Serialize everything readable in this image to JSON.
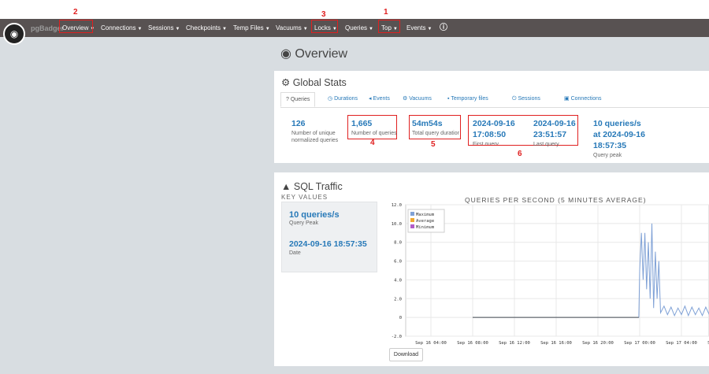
{
  "brand": {
    "name": "pgBadger"
  },
  "nav": [
    {
      "label": "Overview"
    },
    {
      "label": "Connections"
    },
    {
      "label": "Sessions"
    },
    {
      "label": "Checkpoints"
    },
    {
      "label": "Temp Files"
    },
    {
      "label": "Vacuums"
    },
    {
      "label": "Locks"
    },
    {
      "label": "Queries"
    },
    {
      "label": "Top"
    },
    {
      "label": "Events"
    }
  ],
  "annotations": [
    "1",
    "2",
    "3",
    "4",
    "5",
    "6"
  ],
  "page_title": "Overview",
  "global_stats": {
    "title": "Global Stats",
    "tabs": [
      "Queries",
      "Durations",
      "Events",
      "Vacuums",
      "Temporary files",
      "Sessions",
      "Connections"
    ],
    "stats": [
      {
        "value": "126",
        "label1": "Number of unique",
        "label2": "normalized queries"
      },
      {
        "value": "1,665",
        "label1": "Number of queries"
      },
      {
        "value": "54m54s",
        "label1": "Total query duration"
      },
      {
        "value1": "2024-09-16",
        "value2": "17:08:50",
        "label1": "First query"
      },
      {
        "value1": "2024-09-16",
        "value2": "23:51:57",
        "label1": "Last query"
      },
      {
        "value1": "10 queries/s",
        "value2": "at 2024-09-16",
        "value3": "18:57:35",
        "label1": "Query peak"
      }
    ]
  },
  "sql_traffic": {
    "title": "SQL Traffic",
    "key_values_title": "KEY VALUES",
    "peak_value": "10 queries/s",
    "peak_label": "Query Peak",
    "date_value": "2024-09-16 18:57:35",
    "date_label": "Date",
    "download_label": "Download"
  },
  "colors": {
    "navbar": "#585252",
    "accent": "#2779b8",
    "annotation": "#e02020"
  },
  "chart_data": {
    "type": "line",
    "title": "QUERIES PER SECOND (5 MINUTES AVERAGE)",
    "ylim": [
      -2.0,
      12.0
    ],
    "yticks": [
      "12.0",
      "10.0",
      "8.0",
      "6.0",
      "4.0",
      "2.0",
      "0",
      "-2.0"
    ],
    "xticks": [
      "Sep 16 04:00",
      "Sep 16 08:00",
      "Sep 16 12:00",
      "Sep 16 16:00",
      "Sep 16 20:00",
      "Sep 17 00:00",
      "Sep 17 04:00",
      "Sep 17 08:00"
    ],
    "legend": [
      "Maximum",
      "Average",
      "Minimum"
    ],
    "legend_colors": [
      "#7fa1d6",
      "#f0a830",
      "#b25cc8"
    ],
    "grid": true,
    "series": [
      {
        "name": "Maximum",
        "values": [
          [
            "Sep 16 08:00",
            0
          ],
          [
            "Sep 16 23:55",
            0
          ],
          [
            "Sep 17 00:00",
            5
          ],
          [
            "Sep 17 00:10",
            9
          ],
          [
            "Sep 17 00:20",
            4
          ],
          [
            "Sep 17 00:30",
            9
          ],
          [
            "Sep 17 00:40",
            3
          ],
          [
            "Sep 17 00:50",
            8
          ],
          [
            "Sep 17 01:00",
            2
          ],
          [
            "Sep 17 01:10",
            10
          ],
          [
            "Sep 17 01:20",
            1
          ],
          [
            "Sep 17 01:30",
            7
          ],
          [
            "Sep 17 01:40",
            2
          ],
          [
            "Sep 17 01:50",
            6
          ],
          [
            "Sep 17 02:00",
            0.5
          ],
          [
            "Sep 17 02:20",
            1.2
          ],
          [
            "Sep 17 02:40",
            0.3
          ],
          [
            "Sep 17 03:00",
            1.1
          ],
          [
            "Sep 17 03:20",
            0.2
          ],
          [
            "Sep 17 03:40",
            1.0
          ],
          [
            "Sep 17 04:00",
            0.3
          ],
          [
            "Sep 17 04:20",
            1.2
          ],
          [
            "Sep 17 04:40",
            0.2
          ],
          [
            "Sep 17 05:00",
            1.1
          ],
          [
            "Sep 17 05:20",
            0.3
          ],
          [
            "Sep 17 05:40",
            1.0
          ],
          [
            "Sep 17 06:00",
            0.2
          ],
          [
            "Sep 17 06:20",
            1.1
          ],
          [
            "Sep 17 06:40",
            0.3
          ],
          [
            "Sep 17 07:00",
            1.0
          ],
          [
            "Sep 17 07:20",
            0.2
          ]
        ]
      }
    ]
  }
}
